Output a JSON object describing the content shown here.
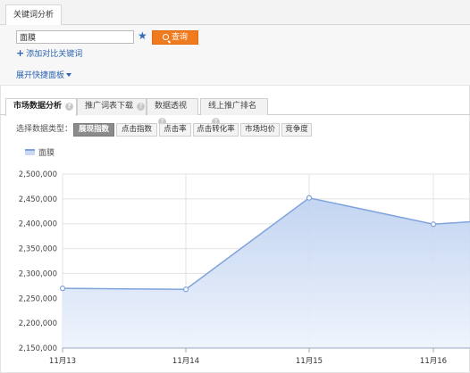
{
  "top_tab": "关键词分析",
  "search": {
    "value": "面膜"
  },
  "query_button": "查询",
  "add_compare_link": "添加对比关键词",
  "expand_panel_link": "展开快捷面板",
  "tabs": [
    {
      "label": "市场数据分析",
      "active": true
    },
    {
      "label": "推广词表下载",
      "active": false
    },
    {
      "label": "数据透视",
      "active": false
    },
    {
      "label": "线上推广排名",
      "active": false
    }
  ],
  "data_type_label": "选择数据类型：",
  "data_types": [
    {
      "label": "展现指数",
      "active": true
    },
    {
      "label": "点击指数",
      "active": false
    },
    {
      "label": "点击率",
      "active": false
    },
    {
      "label": "点击转化率",
      "active": false
    },
    {
      "label": "市场均价",
      "active": false
    },
    {
      "label": "竞争度",
      "active": false
    }
  ],
  "chart_data": {
    "type": "area",
    "series": [
      {
        "name": "面膜",
        "values": [
          2270000,
          2268000,
          2452000,
          2399000,
          2408000
        ]
      }
    ],
    "categories": [
      "11月13",
      "11月14",
      "11月15",
      "11月16",
      ""
    ],
    "ylim": [
      2150000,
      2500000
    ],
    "yticks": [
      "2,150,000",
      "2,200,000",
      "2,250,000",
      "2,300,000",
      "2,350,000",
      "2,400,000",
      "2,450,000",
      "2,500,000"
    ],
    "grid": true,
    "legend_position": "top-left",
    "colors": {
      "line": "#7fa3dc",
      "fill_top": "#bcd0f0",
      "fill_bottom": "#eef3fc",
      "grid": "#e3e3e3"
    }
  },
  "colors": {
    "accent": "#f07a1e",
    "link": "#2a64b0"
  }
}
